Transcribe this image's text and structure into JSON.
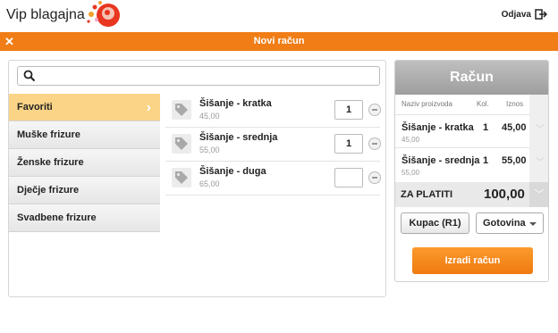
{
  "app": {
    "title": "Vip blagajna",
    "logout_label": "Odjava"
  },
  "dialog": {
    "title": "Novi račun",
    "close_label": "✕"
  },
  "search": {
    "placeholder": "",
    "value": ""
  },
  "categories": [
    {
      "label": "Favoriti",
      "active": true
    },
    {
      "label": "Muške frizure",
      "active": false
    },
    {
      "label": "Ženske frizure",
      "active": false
    },
    {
      "label": "Dječje frizure",
      "active": false
    },
    {
      "label": "Svadbene frizure",
      "active": false
    }
  ],
  "products": [
    {
      "name": "Šišanje - kratka",
      "price": "45,00",
      "qty": "1"
    },
    {
      "name": "Šišanje - srednja",
      "price": "55,00",
      "qty": "1"
    },
    {
      "name": "Šišanje - duga",
      "price": "65,00",
      "qty": ""
    }
  ],
  "bill": {
    "title": "Račun",
    "headers": {
      "name": "Naziv proizvoda",
      "qty": "Kol.",
      "amount": "Iznos"
    },
    "items": [
      {
        "name": "Šišanje - kratka",
        "unit": "45,00",
        "qty": "1",
        "amount": "45,00"
      },
      {
        "name": "Šišanje - srednja",
        "unit": "55,00",
        "qty": "1",
        "amount": "55,00"
      }
    ],
    "total_label": "ZA PLATITI",
    "total_value": "100,00",
    "customer_button": "Kupac (R1)",
    "payment_method": "Gotovina",
    "create_button": "Izradi račun"
  },
  "colors": {
    "accent": "#f07d16",
    "active_category": "#fbd487"
  }
}
